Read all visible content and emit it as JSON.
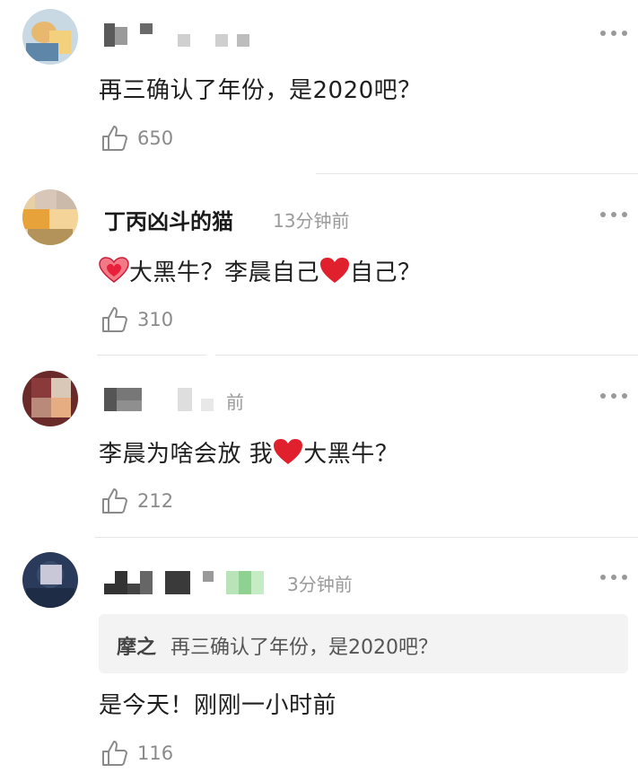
{
  "comments": [
    {
      "username": "",
      "time": "",
      "text": "再三确认了年份，是2020吧？",
      "likes": "650"
    },
    {
      "username": "丁丙凶斗的猫",
      "time": "13分钟前",
      "text_parts": [
        "大黑牛？李晨自己",
        "自己？"
      ],
      "likes": "310"
    },
    {
      "username": "",
      "time": "前",
      "text_parts": [
        "李晨为啥会放 我",
        "大黑牛？"
      ],
      "likes": "212"
    },
    {
      "username": "",
      "time": "3分钟前",
      "quote": {
        "author": "摩之",
        "text": "再三确认了年份，是2020吧？"
      },
      "text": "是今天！刚刚一小时前",
      "likes": "116"
    }
  ],
  "colors": {
    "heart": "#e0202c",
    "muted": "#9a9a9a"
  },
  "icons": {
    "like": "thumbs-up-icon",
    "more": "more-dots-icon",
    "heart": "heart-icon",
    "sparkle_heart": "sparkle-heart-icon"
  }
}
